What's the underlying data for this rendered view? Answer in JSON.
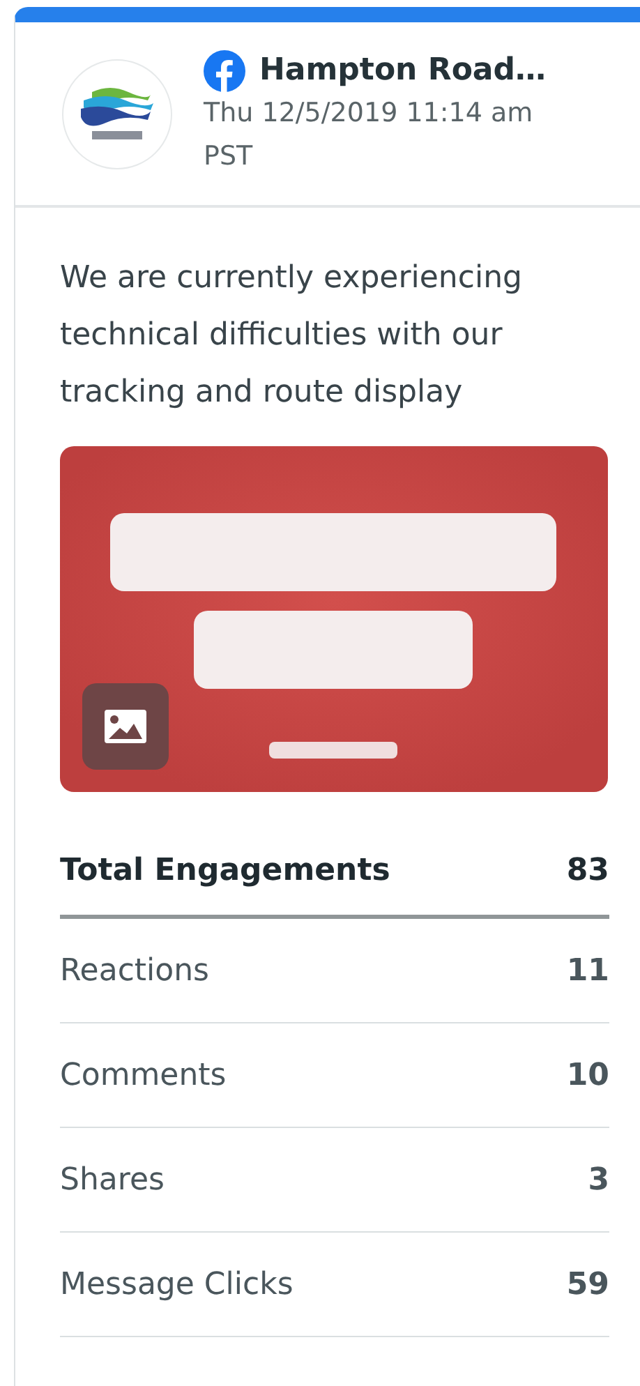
{
  "post": {
    "author": "Hampton Road…",
    "timestamp": "Thu 12/5/2019 11:14 am PST",
    "text": "We are currently experiencing technical difficulties with our tracking and route display"
  },
  "stats": [
    {
      "label": "Total Engagements",
      "value": "83",
      "kind": "total"
    },
    {
      "label": "Reactions",
      "value": "11",
      "kind": "item"
    },
    {
      "label": "Comments",
      "value": "10",
      "kind": "item"
    },
    {
      "label": "Shares",
      "value": "3",
      "kind": "item"
    },
    {
      "label": "Message Clicks",
      "value": "59",
      "kind": "item"
    }
  ]
}
